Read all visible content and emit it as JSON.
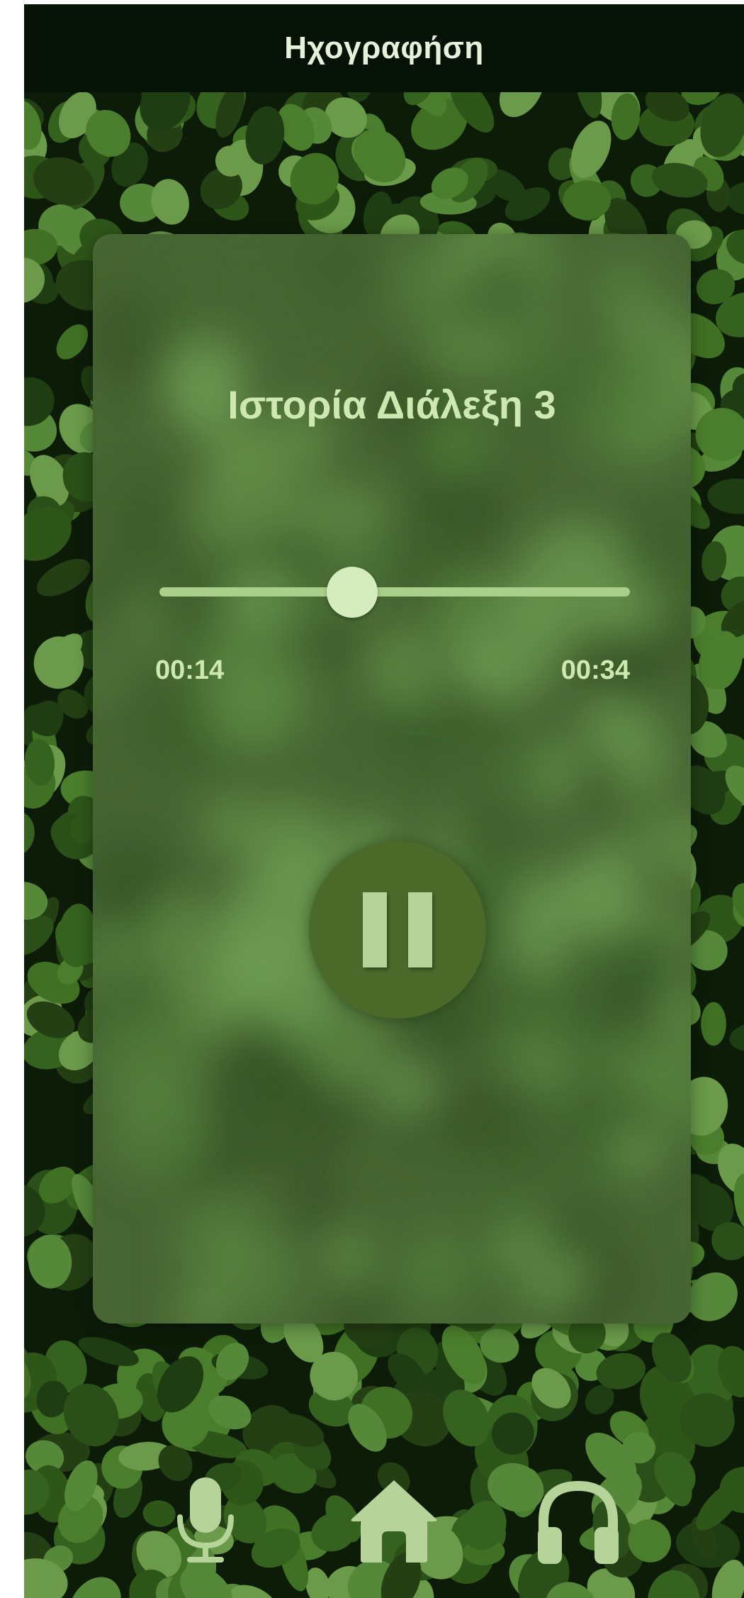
{
  "header": {
    "title": "Ηχογραφήση"
  },
  "player": {
    "track_title": "Ιστορία Διάλεξη 3",
    "current_time": "00:14",
    "total_time": "00:34",
    "progress": 0.41,
    "playing": true,
    "pause_icon": "pause-icon"
  },
  "bottom_nav": {
    "items": [
      {
        "icon": "microphone-icon"
      },
      {
        "icon": "home-icon"
      },
      {
        "icon": "headphones-icon"
      }
    ]
  },
  "colors": {
    "header_bg": "#071207",
    "accent_light": "#cde8b0",
    "button_bg": "#4b6a2a",
    "icon_color": "#b6d39a"
  }
}
